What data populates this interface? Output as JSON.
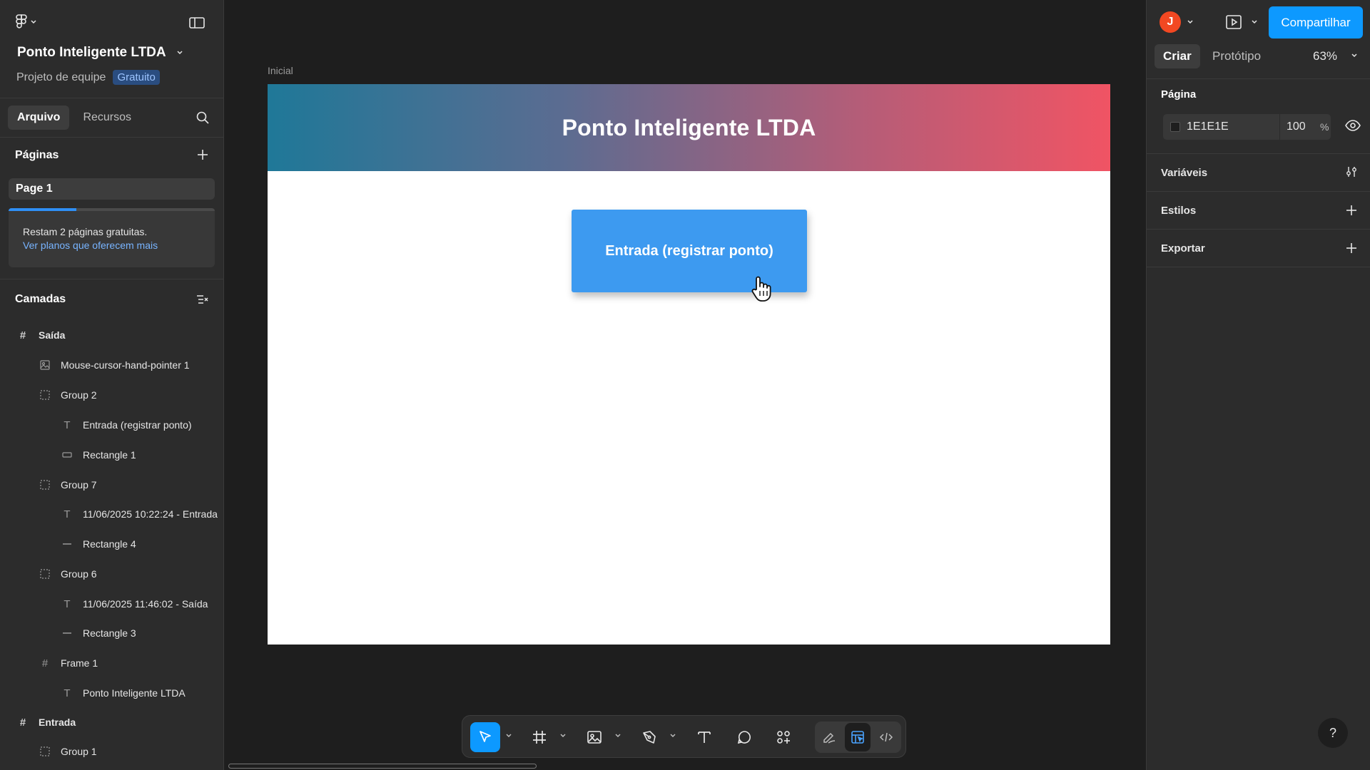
{
  "app": {
    "project_title": "Ponto Inteligente LTDA",
    "team_label": "Projeto de equipe",
    "plan_badge": "Gratuito"
  },
  "left_tabs": [
    {
      "label": "Arquivo"
    },
    {
      "label": "Recursos"
    }
  ],
  "pages_section": {
    "title": "Páginas",
    "items": [
      {
        "label": "Page 1"
      }
    ]
  },
  "promo": {
    "text": "Restam 2 páginas gratuitas.",
    "link": "Ver planos que oferecem mais",
    "progress_fraction": 0.33
  },
  "layers_section": {
    "title": "Camadas",
    "items": [
      {
        "label": "Saída",
        "kind": "frame",
        "depth": 0
      },
      {
        "label": "Mouse-cursor-hand-pointer 1",
        "kind": "image",
        "depth": 1
      },
      {
        "label": "Group 2",
        "kind": "group",
        "depth": 1
      },
      {
        "label": "Entrada (registrar ponto)",
        "kind": "text",
        "depth": 2
      },
      {
        "label": "Rectangle 1",
        "kind": "rect",
        "depth": 2
      },
      {
        "label": "Group 7",
        "kind": "group",
        "depth": 1
      },
      {
        "label": "11/06/2025 10:22:24 - Entrada",
        "kind": "text",
        "depth": 2
      },
      {
        "label": "Rectangle 4",
        "kind": "line",
        "depth": 2
      },
      {
        "label": "Group 6",
        "kind": "group",
        "depth": 1
      },
      {
        "label": "11/06/2025 11:46:02 - Saída",
        "kind": "text",
        "depth": 2
      },
      {
        "label": "Rectangle 3",
        "kind": "line",
        "depth": 2
      },
      {
        "label": "Frame 1",
        "kind": "frame-inner",
        "depth": 1
      },
      {
        "label": "Ponto Inteligente LTDA",
        "kind": "text",
        "depth": 2
      },
      {
        "label": "Entrada",
        "kind": "frame",
        "depth": 0
      },
      {
        "label": "Group 1",
        "kind": "group",
        "depth": 1
      }
    ]
  },
  "canvas": {
    "frame_label": "Inicial",
    "banner_title": "Ponto Inteligente LTDA",
    "button_label": "Entrada (registrar ponto)",
    "banner_colors": [
      "#1f7898",
      "#f05464"
    ],
    "button_color": "#3d9af0"
  },
  "toolbar": {
    "tools": [
      "move-tool",
      "frame-tool",
      "image-tool",
      "pen-tool",
      "text-tool",
      "comment-tool",
      "actions-tool"
    ],
    "modes": [
      "draw-mode",
      "design-mode",
      "dev-mode"
    ],
    "accent": "#0d99ff"
  },
  "right_panel": {
    "avatar_letter": "J",
    "share_label": "Compartilhar",
    "tabs": [
      {
        "label": "Criar"
      },
      {
        "label": "Protótipo"
      }
    ],
    "zoom": "63%",
    "page_title": "Página",
    "page_color_hex": "1E1E1E",
    "page_opacity": "100",
    "percent_sign": "%",
    "variables_label": "Variáveis",
    "styles_label": "Estilos",
    "export_label": "Exportar",
    "help_label": "?"
  }
}
